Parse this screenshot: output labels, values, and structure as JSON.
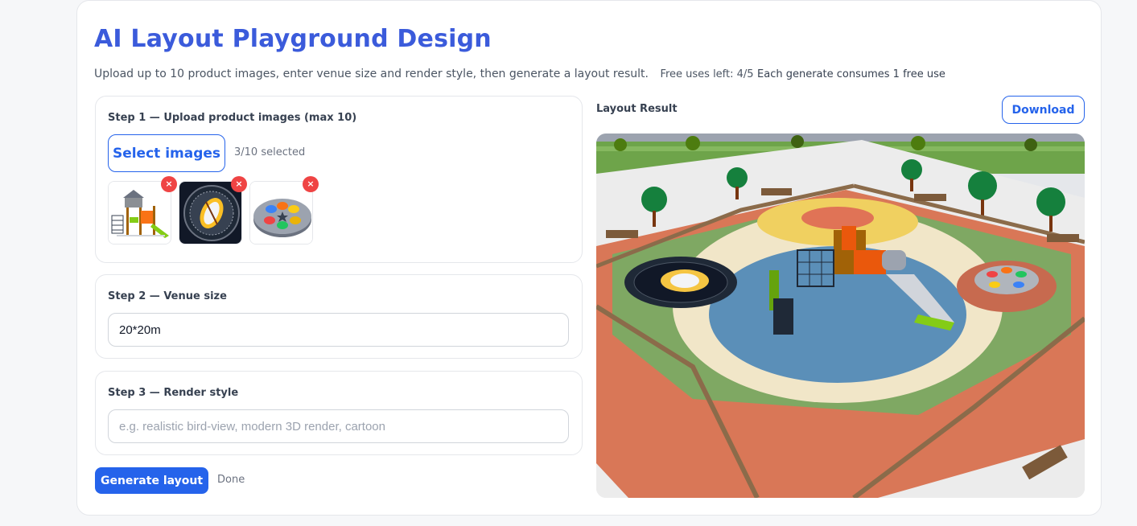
{
  "header": {
    "title": "AI Layout Playground Design",
    "subtitle": "Upload up to 10 product images, enter venue size and render style, then generate a layout result.",
    "free_uses": "Free uses left: 4/5",
    "uses_note": "Each generate consumes 1 free use"
  },
  "step1": {
    "label": "Step 1 — Upload product images (max 10)",
    "select_label": "Select images",
    "count": "3/10 selected",
    "remove_symbol": "×",
    "images": [
      "playground-structure",
      "trampoline",
      "spinner-disc"
    ]
  },
  "step2": {
    "label": "Step 2 — Venue size",
    "value": "20*20m"
  },
  "step3": {
    "label": "Step 3 — Render style",
    "value": "",
    "placeholder": "e.g. realistic bird-view, modern 3D render, cartoon"
  },
  "actions": {
    "generate_label": "Generate layout",
    "status": "Done"
  },
  "result": {
    "label": "Layout Result",
    "download_label": "Download"
  },
  "colors": {
    "accent": "#2563eb",
    "title": "#3b5bdb",
    "remove": "#ef4444"
  }
}
